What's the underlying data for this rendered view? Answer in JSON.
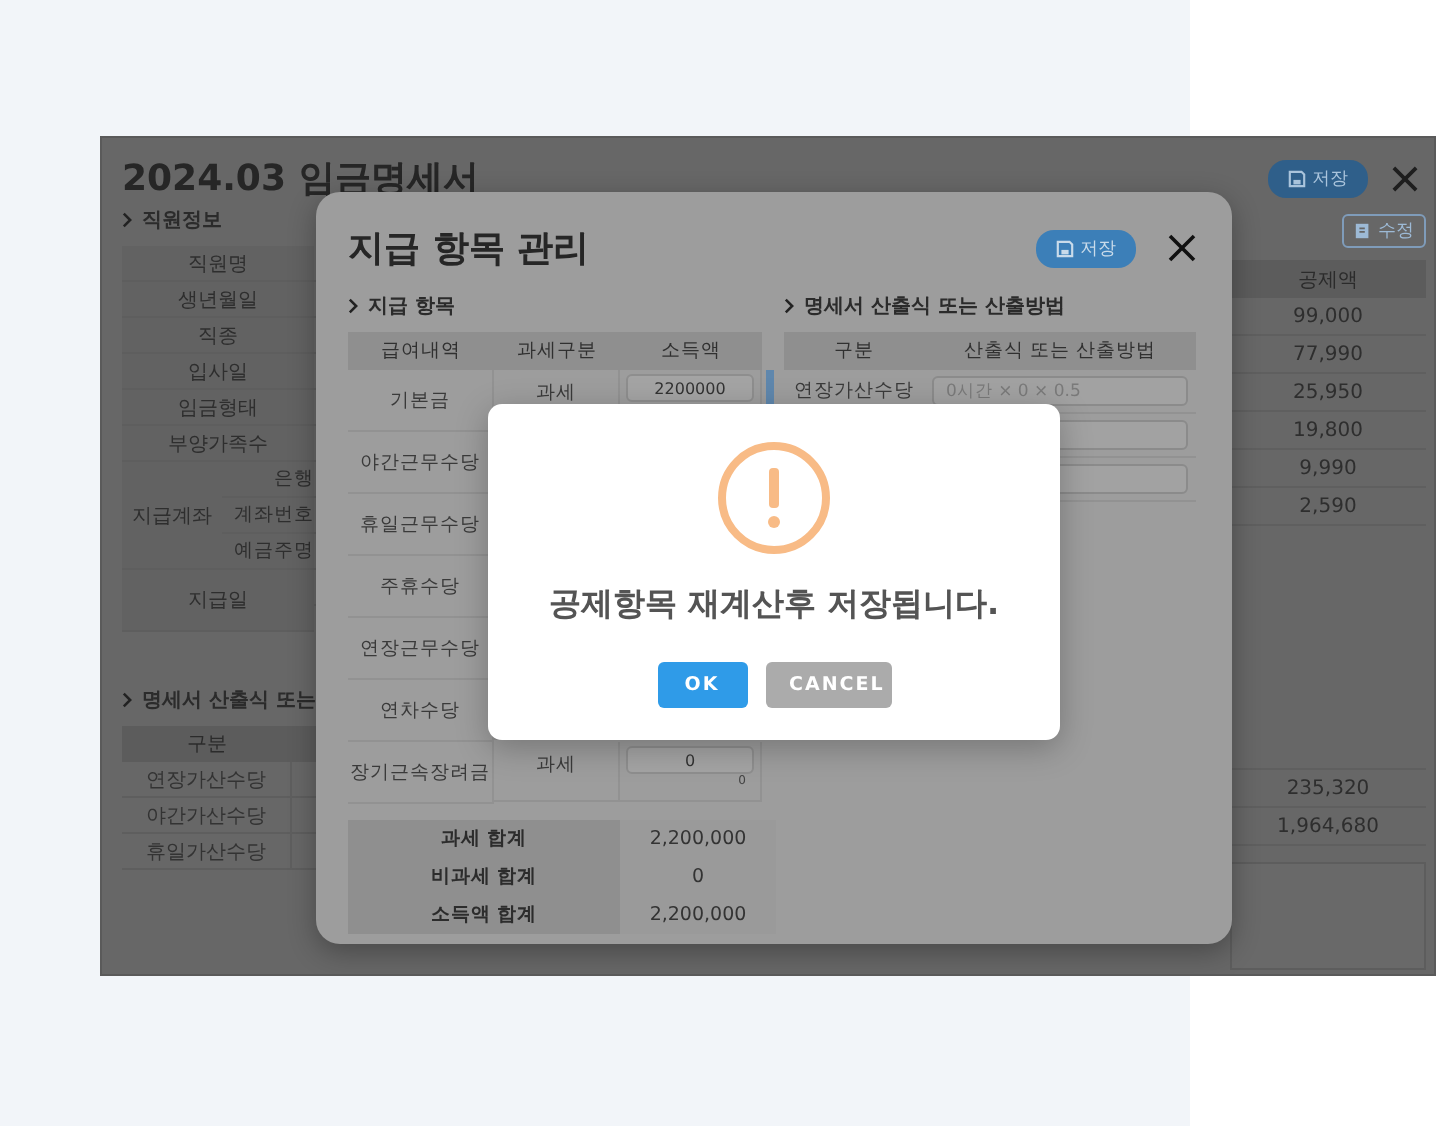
{
  "screen": {
    "title": "2024.03 임금명세서",
    "save_label": "저장",
    "edit_label": "수정",
    "employee_heading": "직원정보",
    "employee_rows": [
      "직원명",
      "생년월일",
      "직종",
      "입사일",
      "임금형태",
      "부양가족수"
    ],
    "account": {
      "label": "지급계좌",
      "parts": [
        "은행",
        "계좌번호",
        "예금주명"
      ]
    },
    "pay_date_label": "지급일",
    "formula_heading": "명세서 산출식 또는",
    "formula_column": "구분",
    "formula_rows": [
      "연장가산수당",
      "야간가산수당",
      "휴일가산수당"
    ],
    "deduction_column": "공제액",
    "deductions": [
      "99,000",
      "77,990",
      "25,950",
      "19,800",
      "9,990",
      "2,590"
    ],
    "totals": [
      "235,320",
      "1,964,680"
    ]
  },
  "modal": {
    "title": "지급 항목 관리",
    "save_label": "저장",
    "pay_heading": "지급 항목",
    "columns": [
      "급여내역",
      "과세구분",
      "소득액"
    ],
    "rows": [
      {
        "name": "기본금",
        "tax": "과세",
        "amount": "2200000"
      },
      {
        "name": "야간근무수당"
      },
      {
        "name": "휴일근무수당"
      },
      {
        "name": "주휴수당"
      },
      {
        "name": "연장근무수당"
      },
      {
        "name": "연차수당"
      },
      {
        "name": "장기근속장려금",
        "tax": "과세",
        "amount": "0",
        "note": "0"
      }
    ],
    "summary": [
      {
        "label": "과세 합계",
        "value": "2,200,000"
      },
      {
        "label": "비과세 합계",
        "value": "0"
      },
      {
        "label": "소득액 합계",
        "value": "2,200,000"
      }
    ],
    "formula_heading": "명세서 산출식 또는 산출방법",
    "formula_columns": [
      "구분",
      "산출식 또는 산출방법"
    ],
    "formula_rows": [
      {
        "name": "연장가산수당",
        "placeholder": "0시간 × 0 × 0.5"
      },
      {},
      {}
    ]
  },
  "alert": {
    "message": "공제항목 재계산후 저장됩니다.",
    "buttons": [
      {
        "label": "OK",
        "kind": "primary"
      },
      {
        "label": "CANCEL",
        "kind": "secondary"
      }
    ]
  }
}
